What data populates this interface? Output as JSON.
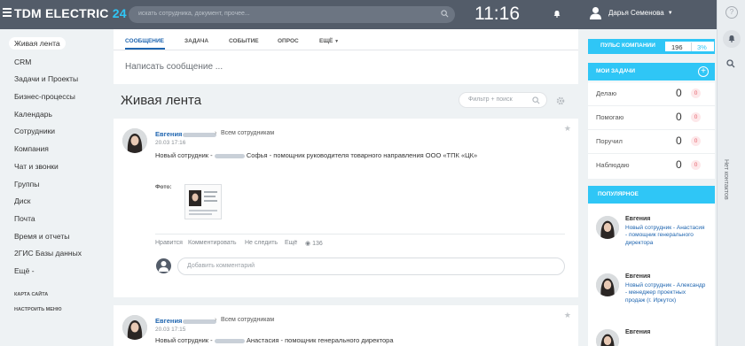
{
  "header": {
    "brand": "TDM ELECTRIC",
    "brand_number": "24",
    "search_placeholder": "искать сотрудника, документ, прочее...",
    "clock": "11:16",
    "user_name": "Дарья Семенова"
  },
  "menu": {
    "items": [
      {
        "label": "Живая лента",
        "active": true
      },
      {
        "label": "CRM"
      },
      {
        "label": "Задачи и Проекты"
      },
      {
        "label": "Бизнес-процессы"
      },
      {
        "label": "Календарь"
      },
      {
        "label": "Сотрудники"
      },
      {
        "label": "Компания"
      },
      {
        "label": "Чат и звонки"
      },
      {
        "label": "Группы"
      },
      {
        "label": "Диск"
      },
      {
        "label": "Почта"
      },
      {
        "label": "Время и отчеты"
      },
      {
        "label": "2ГИС Базы данных"
      },
      {
        "label": "Ещё -"
      }
    ],
    "site_map": "КАРТА САЙТА",
    "configure": "НАСТРОИТЬ МЕНЮ"
  },
  "composer": {
    "tabs": [
      "СООБЩЕНИЕ",
      "ЗАДАЧА",
      "СОБЫТИЕ",
      "ОПРОС",
      "ЕЩЁ"
    ],
    "placeholder": "Написать сообщение ..."
  },
  "feed": {
    "title": "Живая лента",
    "filter_placeholder": "Фильтр + поиск"
  },
  "posts": [
    {
      "author": "Евгения",
      "audience": "Всем сотрудникам",
      "date": "20.03 17:16",
      "text_prefix": "Новый сотрудник -",
      "text_suffix": "Софья - помощник руководителя товарного направления ООО «ТПК «ЦК»",
      "photo_label": "Фото:",
      "actions": [
        "Нравится",
        "Комментировать",
        "Не следить",
        "Ещё"
      ],
      "views": "136",
      "comment_placeholder": "Добавить комментарий"
    },
    {
      "author": "Евгения",
      "audience": "Всем сотрудникам",
      "date": "20.03 17:15",
      "text_prefix": "Новый сотрудник -",
      "text_suffix": "Анастасия - помощник генерального директора"
    }
  ],
  "pulse": {
    "label": "ПУЛЬС КОМПАНИИ",
    "value": "196",
    "percent": "3%"
  },
  "tasks": {
    "title": "МОИ ЗАДАЧИ",
    "rows": [
      {
        "name": "Делаю",
        "count": "0",
        "badge": "0"
      },
      {
        "name": "Помогаю",
        "count": "0",
        "badge": "0"
      },
      {
        "name": "Поручил",
        "count": "0",
        "badge": "0"
      },
      {
        "name": "Наблюдаю",
        "count": "0",
        "badge": "0"
      }
    ]
  },
  "popular": {
    "title": "ПОПУЛЯРНОЕ",
    "items": [
      {
        "name": "Евгения",
        "text": "Новый сотрудник - Анастасия - помощник генерального директора"
      },
      {
        "name": "Евгения",
        "text": "Новый сотрудник - Александр - менеджер проектных продаж (г. Иркутск)"
      },
      {
        "name": "Евгения"
      }
    ]
  },
  "right_strip": {
    "help": "?",
    "contacts_label": "Нет контактов"
  },
  "colors": {
    "header": "#535c69",
    "accent": "#2fc6f6",
    "link": "#2066b0",
    "badge": "#e6616c"
  }
}
